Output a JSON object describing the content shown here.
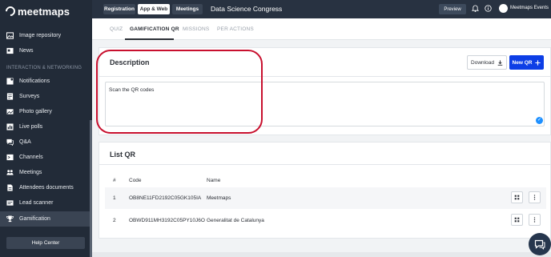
{
  "sidebar": {
    "logo_text": "meetmaps",
    "items": [
      {
        "label": "Image repository",
        "icon": "image-icon"
      },
      {
        "label": "News",
        "icon": "news-icon"
      },
      {
        "label": "Notifications",
        "icon": "notification-icon"
      },
      {
        "label": "Surveys",
        "icon": "survey-icon"
      },
      {
        "label": "Photo gallery",
        "icon": "photo-icon"
      },
      {
        "label": "Live polls",
        "icon": "poll-icon"
      },
      {
        "label": "Q&A",
        "icon": "qa-icon"
      },
      {
        "label": "Channels",
        "icon": "channels-icon"
      },
      {
        "label": "Meetings",
        "icon": "meetings-icon"
      },
      {
        "label": "Attendees documents",
        "icon": "documents-icon"
      },
      {
        "label": "Lead scanner",
        "icon": "scanner-icon"
      },
      {
        "label": "Gamification",
        "icon": "trophy-icon"
      }
    ],
    "section_label": "INTERACTION & NETWORKING",
    "help_label": "Help Center"
  },
  "topbar": {
    "tabs": [
      "Registration",
      "App & Web",
      "Meetings"
    ],
    "active_tab": "App & Web",
    "event_title": "Data Science Congress",
    "preview_label": "Preview",
    "user_name": "Meetmaps Events"
  },
  "subtabs": [
    "QUIZ",
    "GAMIFICATION QR",
    "MISSIONS",
    "PER ACTIONS"
  ],
  "active_subtab": "GAMIFICATION QR",
  "description": {
    "title": "Description",
    "download_label": "Download",
    "new_qr_label": "New QR",
    "text": "Scan the QR codes"
  },
  "list": {
    "title": "List QR",
    "columns": [
      "#",
      "Code",
      "Name"
    ],
    "rows": [
      {
        "num": "1",
        "code": "OB8NE11FD2192C05GK105IA",
        "name": "Meetmaps"
      },
      {
        "num": "2",
        "code": "OBWD911MH3192C05PY10J6O",
        "name": "Generalitat de Catalunya"
      }
    ]
  },
  "colors": {
    "sidebar_bg": "#222b38",
    "topbar_bg": "#283241",
    "primary": "#0d3ee6",
    "annotation": "#c8102e"
  }
}
